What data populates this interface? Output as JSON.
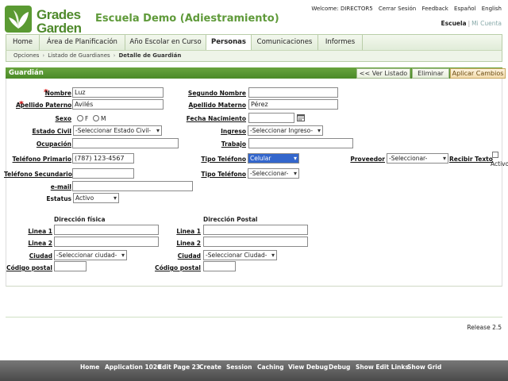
{
  "app": {
    "logo_line1": "Grades",
    "logo_line2": "Garden",
    "title": "Escuela Demo (Adiestramiento)"
  },
  "top_links": {
    "welcome": "Welcome: DIRECTOR5",
    "logout": "Cerrar Sesión",
    "feedback": "Feedback",
    "espanol": "Español",
    "english": "English"
  },
  "scope": {
    "active": "Escuela",
    "separator": "|",
    "other": "Mi Cuenta"
  },
  "tabs": [
    {
      "label": "Home"
    },
    {
      "label": "Área de Planificación"
    },
    {
      "label": "Año Escolar en Curso"
    },
    {
      "label": "Personas"
    },
    {
      "label": "Comunicaciones"
    },
    {
      "label": "Informes"
    }
  ],
  "breadcrumb": {
    "items": [
      "Opciones",
      "Listado de Guardianes"
    ],
    "current": "Detalle de Guardián"
  },
  "region": {
    "title": "Guardián",
    "btn_list": "<< Ver Listado",
    "btn_delete": "Eliminar",
    "btn_apply": "Aplicar Cambios"
  },
  "form": {
    "nombre_label": "Nombre",
    "nombre_value": "Luz",
    "segundo_nombre_label": "Segundo Nombre",
    "segundo_nombre_value": "",
    "apellido_paterno_label": "Apellido Paterno",
    "apellido_paterno_value": "Avilés",
    "apellido_materno_label": "Apellido Materno",
    "apellido_materno_value": "Pérez",
    "sexo_label": "Sexo",
    "sexo_f": "F",
    "sexo_m": "M",
    "fecha_nacimiento_label": "Fecha Nacimiento",
    "fecha_nacimiento_value": "",
    "estado_civil_label": "Estado Civil",
    "estado_civil_value": "-Seleccionar Estado Civil-",
    "ingreso_label": "Ingreso",
    "ingreso_value": "-Seleccionar Ingreso-",
    "ocupacion_label": "Ocupación",
    "ocupacion_value": "",
    "trabajo_label": "Trabajo",
    "trabajo_value": "",
    "telefono_primario_label": "Teléfono Primario",
    "telefono_primario_value": "(787) 123-4567",
    "tipo_telefono_label": "Tipo Teléfono",
    "tipo_telefono_value": "Celular",
    "proveedor_label": "Proveedor",
    "proveedor_value": "-Seleccionar-",
    "recibir_texto_label": "Recibir Texto",
    "activo_label": "Activo",
    "telefono_secundario_label": "Teléfono Secundario",
    "telefono_secundario_value": "",
    "tipo_telefono2_label": "Tipo Teléfono",
    "tipo_telefono2_value": "-Seleccionar-",
    "email_label": "e-mail",
    "email_value": "",
    "estatus_label": "Estatus",
    "estatus_value": "Activo"
  },
  "address": {
    "fisica_title": "Dirección física",
    "postal_title": "Dirección Postal",
    "linea1_label": "Linea 1",
    "linea2_label": "Linea 2",
    "ciudad_label": "Ciudad",
    "codigo_postal_label": "Código postal",
    "fisica_ciudad_value": "-Seleccionar ciudad-",
    "postal_ciudad_value": "-Seleccionar Ciudad-"
  },
  "footer": {
    "release": "Release 2.5"
  },
  "devbar": {
    "items": [
      "Home",
      "Application 1020",
      "Edit Page 23",
      "Create",
      "Session",
      "Caching",
      "View Debug",
      "Debug",
      "Show Edit Links",
      "Show Grid"
    ]
  },
  "colors": {
    "brand_green": "#4f8a2c",
    "region_header": "#5a9a32",
    "select_focus": "#3366cc",
    "required": "#cc0000"
  }
}
